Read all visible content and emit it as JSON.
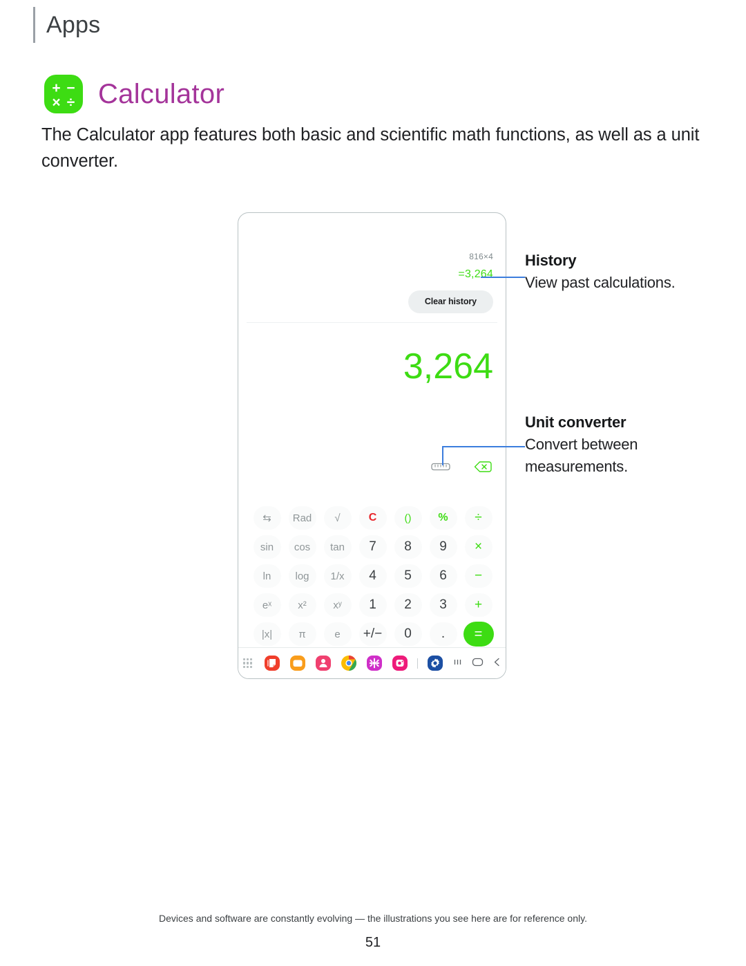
{
  "header": {
    "section_title": "Apps"
  },
  "app": {
    "name": "Calculator",
    "icon": "calculator-app-icon",
    "icon_color": "#3ddc13",
    "title_color": "#a4349a",
    "icon_glyphs": [
      "+",
      "−",
      "×",
      "÷"
    ]
  },
  "intro": {
    "text": "The Calculator app features both basic and scientific math functions, as well as a unit converter."
  },
  "device": {
    "history": {
      "expression": "816×4",
      "result": "=3,264",
      "clear_button": "Clear history"
    },
    "display": {
      "result": "3,264",
      "result_color": "#3ddc13"
    },
    "tools": [
      {
        "name": "unit-converter-icon",
        "label": "Unit converter"
      },
      {
        "name": "backspace-icon",
        "label": "Backspace"
      }
    ],
    "keypad": {
      "rows": [
        [
          {
            "label": "⇆",
            "kind": "fn",
            "name": "toggle-mode-key"
          },
          {
            "label": "Rad",
            "kind": "fn",
            "name": "rad-key"
          },
          {
            "label": "√",
            "kind": "fn",
            "name": "sqrt-key"
          },
          {
            "label": "C",
            "kind": "clear",
            "name": "clear-key"
          },
          {
            "label": "()",
            "kind": "paren",
            "name": "parentheses-key"
          },
          {
            "label": "%",
            "kind": "pct",
            "name": "percent-key"
          },
          {
            "label": "÷",
            "kind": "op",
            "name": "divide-key"
          }
        ],
        [
          {
            "label": "sin",
            "kind": "fn",
            "name": "sin-key"
          },
          {
            "label": "cos",
            "kind": "fn",
            "name": "cos-key"
          },
          {
            "label": "tan",
            "kind": "fn",
            "name": "tan-key"
          },
          {
            "label": "7",
            "kind": "num",
            "name": "digit-7-key"
          },
          {
            "label": "8",
            "kind": "num",
            "name": "digit-8-key"
          },
          {
            "label": "9",
            "kind": "num",
            "name": "digit-9-key"
          },
          {
            "label": "×",
            "kind": "op",
            "name": "multiply-key"
          }
        ],
        [
          {
            "label": "ln",
            "kind": "fn",
            "name": "ln-key"
          },
          {
            "label": "log",
            "kind": "fn",
            "name": "log-key"
          },
          {
            "label": "1/x",
            "kind": "fn",
            "name": "reciprocal-key"
          },
          {
            "label": "4",
            "kind": "num",
            "name": "digit-4-key"
          },
          {
            "label": "5",
            "kind": "num",
            "name": "digit-5-key"
          },
          {
            "label": "6",
            "kind": "num",
            "name": "digit-6-key"
          },
          {
            "label": "−",
            "kind": "op",
            "name": "minus-key"
          }
        ],
        [
          {
            "label": "eˣ",
            "kind": "fn",
            "name": "exp-key"
          },
          {
            "label": "x²",
            "kind": "fn",
            "name": "square-key"
          },
          {
            "label": "xʸ",
            "kind": "fn",
            "name": "power-key"
          },
          {
            "label": "1",
            "kind": "num",
            "name": "digit-1-key"
          },
          {
            "label": "2",
            "kind": "num",
            "name": "digit-2-key"
          },
          {
            "label": "3",
            "kind": "num",
            "name": "digit-3-key"
          },
          {
            "label": "+",
            "kind": "op",
            "name": "plus-key"
          }
        ],
        [
          {
            "label": "|x|",
            "kind": "fn",
            "name": "absolute-key"
          },
          {
            "label": "π",
            "kind": "fn",
            "name": "pi-key"
          },
          {
            "label": "e",
            "kind": "fn",
            "name": "euler-key"
          },
          {
            "label": "+/−",
            "kind": "num",
            "name": "sign-key"
          },
          {
            "label": "0",
            "kind": "num",
            "name": "digit-0-key"
          },
          {
            "label": ".",
            "kind": "num",
            "name": "decimal-key"
          },
          {
            "label": "=",
            "kind": "equals",
            "name": "equals-key"
          }
        ]
      ]
    },
    "taskbar": {
      "items": [
        {
          "name": "apps-grid-icon"
        },
        {
          "name": "samsung-notes-icon",
          "color": "#f03e2b"
        },
        {
          "name": "my-files-icon",
          "color": "#f99d1c"
        },
        {
          "name": "contacts-icon",
          "color": "#f0406f"
        },
        {
          "name": "chrome-icon",
          "color": "#4285f4"
        },
        {
          "name": "gallery-icon",
          "color": "#cf2fc8"
        },
        {
          "name": "instagram-icon",
          "color": "#ee1b7a"
        },
        {
          "name": "divider"
        },
        {
          "name": "settings-icon",
          "color": "#1c4fa3"
        },
        {
          "name": "recents-button"
        },
        {
          "name": "home-button"
        },
        {
          "name": "back-button"
        }
      ]
    }
  },
  "callouts": [
    {
      "title": "History",
      "body": "View past calculations.",
      "leader_color": "#3b7ddd"
    },
    {
      "title": "Unit converter",
      "body": "Convert between measurements.",
      "leader_color": "#3b7ddd"
    }
  ],
  "footer": {
    "disclaimer": "Devices and software are constantly evolving — the illustrations you see here are for reference only.",
    "page_number": "51"
  }
}
